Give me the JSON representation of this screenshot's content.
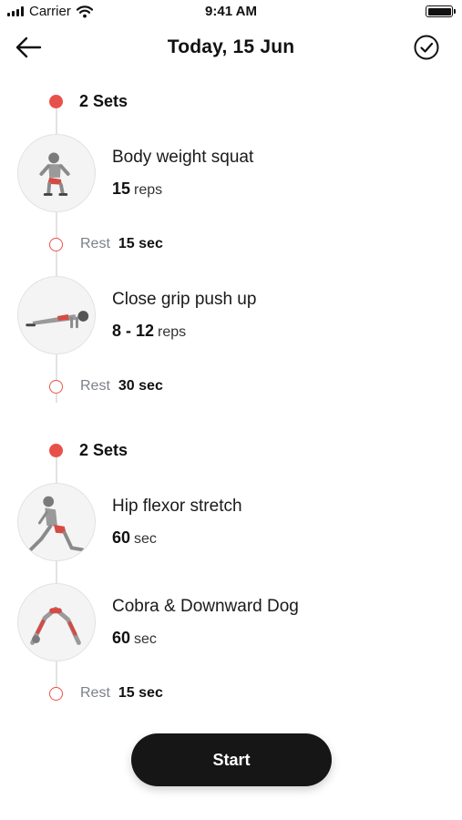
{
  "status_bar": {
    "carrier": "Carrier",
    "time": "9:41 AM"
  },
  "nav": {
    "title": "Today, 15 Jun",
    "back_icon": "arrow-left-icon",
    "done_icon": "check-circle-icon"
  },
  "timeline": {
    "groups": [
      {
        "sets_label": "2 Sets"
      },
      {
        "sets_label": "2 Sets"
      }
    ],
    "exercises": [
      {
        "name": "Body weight squat",
        "amount": "15",
        "unit": "reps"
      },
      {
        "name": "Close grip push up",
        "amount": "8 - 12",
        "unit": "reps"
      },
      {
        "name": "Hip flexor stretch",
        "amount": "60",
        "unit": "sec"
      },
      {
        "name": "Cobra & Downward Dog",
        "amount": "60",
        "unit": "sec"
      }
    ],
    "rests": [
      {
        "label": "Rest",
        "value": "15 sec"
      },
      {
        "label": "Rest",
        "value": "30 sec"
      },
      {
        "label": "Rest",
        "value": "15 sec"
      }
    ]
  },
  "start_button": {
    "label": "Start"
  },
  "colors": {
    "accent": "#e8514a",
    "button": "#161616",
    "muted": "#7d8189"
  }
}
